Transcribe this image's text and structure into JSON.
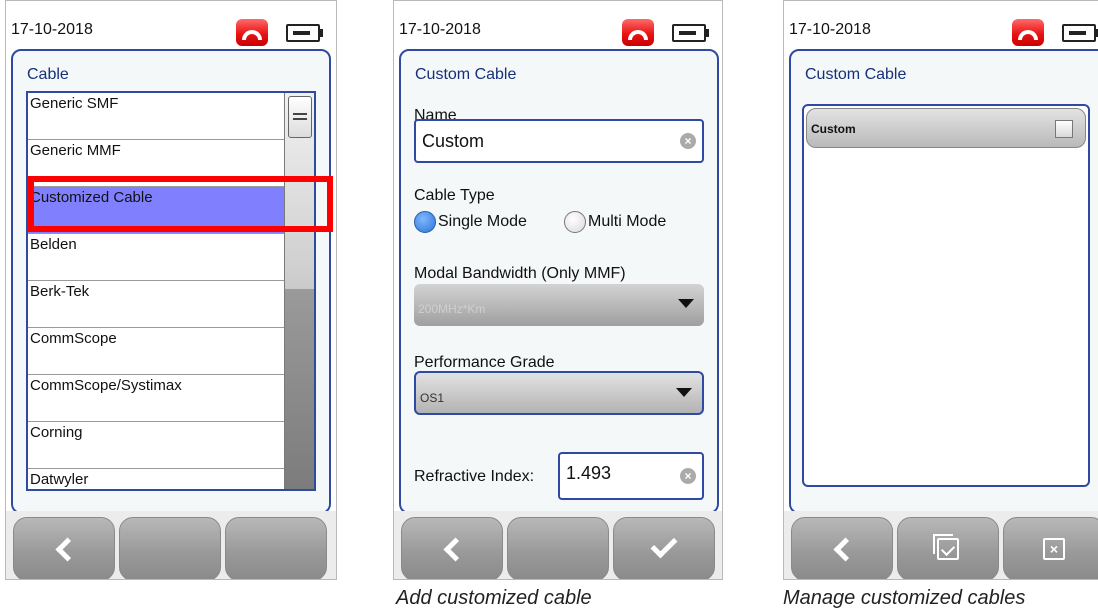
{
  "screen1": {
    "date": "17-10-2018",
    "panel_title": "Cable",
    "items": [
      "Generic SMF",
      "Generic MMF",
      "Customized Cable",
      "Belden",
      "Berk-Tek",
      "CommScope",
      "CommScope/Systimax",
      "Corning",
      "Datwyler"
    ],
    "selected_index": 2
  },
  "screen2": {
    "date": "17-10-2018",
    "panel_title": "Custom Cable",
    "name_label": "Name",
    "name_value": "Custom",
    "cable_type_label": "Cable Type",
    "single_mode": "Single Mode",
    "multi_mode": "Multi Mode",
    "single_mode_checked": true,
    "modal_bw_label": "Modal Bandwidth (Only MMF)",
    "modal_bw_value": "200MHz*Km",
    "perf_grade_label": "Performance Grade",
    "perf_grade_value": "OS1",
    "refractive_label": "Refractive Index:",
    "refractive_value": "1.493",
    "caption": "Add customized cable"
  },
  "screen3": {
    "date": "17-10-2018",
    "panel_title": "Custom Cable",
    "items": [
      "Custom"
    ],
    "caption": "Manage customized cables"
  },
  "colors": {
    "accent_blue": "#2e4aa3",
    "selection": "#8080ff",
    "highlight_red": "#ff0000",
    "call_red": "#e81414"
  },
  "icons": [
    "call-icon",
    "battery-icon",
    "back-chevron-icon",
    "checkmark-icon",
    "duplicate-icon",
    "delete-icon",
    "clear-icon"
  ]
}
